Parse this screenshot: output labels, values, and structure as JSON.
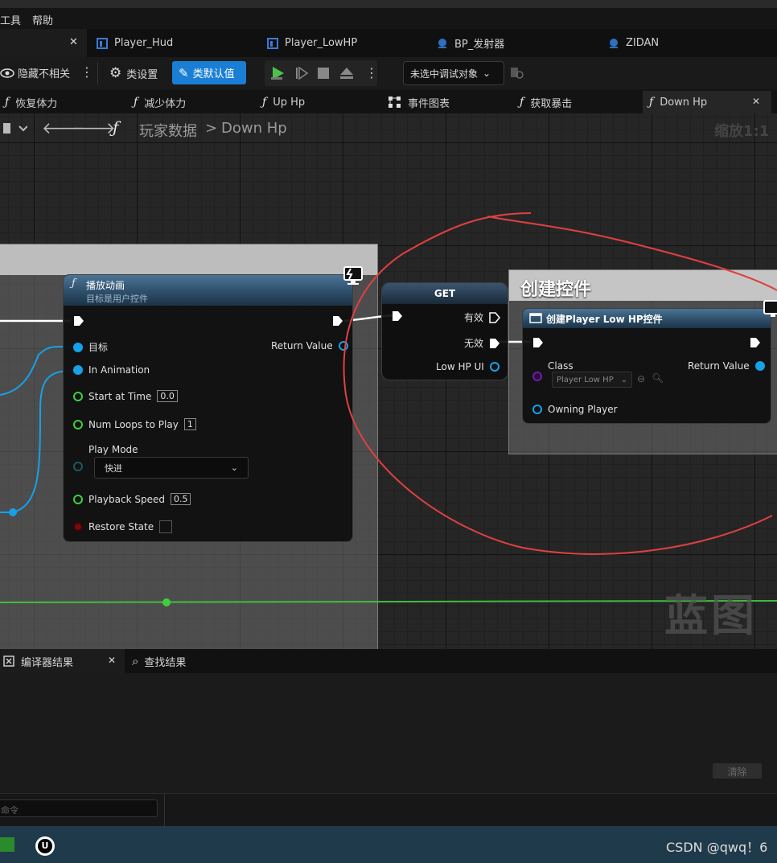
{
  "menu": {
    "tools": "工具",
    "help": "帮助"
  },
  "doc_tabs": [
    "Player_Hud",
    "Player_LowHP",
    "BP_发射器",
    "ZIDAN"
  ],
  "toolbar": {
    "hide_unrelated": "隐藏不相关",
    "class_settings": "类设置",
    "class_defaults": "类默认值",
    "debug_target": "未选中调试对象"
  },
  "function_tabs": [
    "恢复体力",
    "减少体力",
    "Up Hp",
    "事件图表",
    "获取暴击",
    "Down Hp"
  ],
  "breadcrumb": {
    "root": "玩家数据",
    "sep": ">",
    "current": "Down Hp",
    "zoom": "缩放1:1"
  },
  "nodes": {
    "play_anim": {
      "title": "播放动画",
      "subtitle": "目标是用户控件",
      "target": "目标",
      "in_animation": "In Animation",
      "start_at_time": "Start at Time",
      "start_at_time_value": "0.0",
      "num_loops": "Num Loops to Play",
      "num_loops_value": "1",
      "play_mode": "Play Mode",
      "play_mode_value": "快进",
      "playback_speed": "Playback Speed",
      "playback_speed_value": "0.5",
      "restore_state": "Restore State",
      "return_value": "Return Value"
    },
    "get": {
      "title": "GET",
      "valid": "有效",
      "invalid": "无效",
      "low_hp_ui": "Low HP UI"
    },
    "create_widget": {
      "comment": "创建控件",
      "title": "创建Player Low HP控件",
      "class": "Class",
      "class_value": "Player Low HP",
      "return_value": "Return Value",
      "owning_player": "Owning Player"
    }
  },
  "watermark": "蓝图",
  "bottom": {
    "compiler_results": "编译器结果",
    "find_results": "查找结果",
    "clear": "清除",
    "console_placeholder": "命令"
  },
  "taskbar": {
    "csdn": "CSDN @qwq！6"
  },
  "colors": {
    "exec_white": "#ffffff",
    "object_pin": "#16a1e8",
    "float_pin": "#3fcf3f",
    "annotation": "#e04040",
    "accent": "#1a7fd4"
  }
}
